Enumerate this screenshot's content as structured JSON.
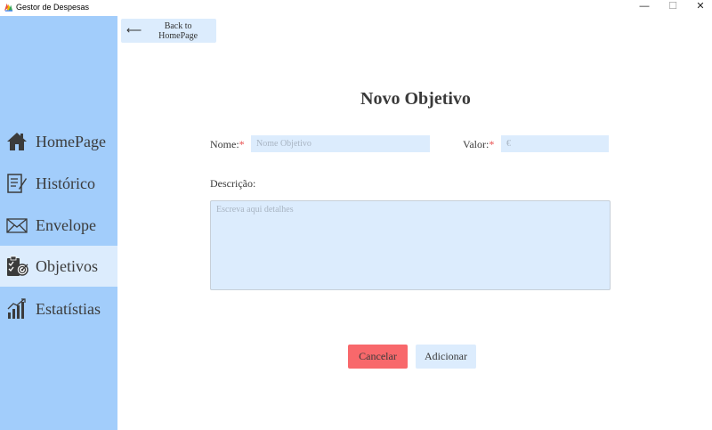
{
  "window": {
    "title": "Gestor de Despesas",
    "minimize": "—",
    "maximize": "☐",
    "close": "✕"
  },
  "sidebar": {
    "items": [
      {
        "label": "HomePage",
        "icon": "home-icon",
        "active": false
      },
      {
        "label": "Histórico",
        "icon": "history-icon",
        "active": false
      },
      {
        "label": "Envelope",
        "icon": "envelope-icon",
        "active": false
      },
      {
        "label": "Objetivos",
        "icon": "objectives-icon",
        "active": true
      },
      {
        "label": "Estatístias",
        "icon": "stats-icon",
        "active": false
      }
    ]
  },
  "back_button": {
    "arrow": "⟵",
    "label": "Back to HomePage"
  },
  "form": {
    "title": "Novo Objetivo",
    "name_label": "Nome:",
    "name_placeholder": "Nome Objetivo",
    "name_value": "",
    "value_label": "Valor:",
    "value_placeholder": "€",
    "value_value": "",
    "required_mark": "*",
    "description_label": "Descrição:",
    "description_placeholder": "Escreva aqui detalhes",
    "description_value": ""
  },
  "actions": {
    "cancel_label": "Cancelar",
    "add_label": "Adicionar"
  },
  "colors": {
    "sidebar": "#a2cdfb",
    "active_item": "#dcecfd",
    "input_bg": "#dcecfd",
    "cancel": "#f8686b",
    "required": "#e84c4c"
  }
}
